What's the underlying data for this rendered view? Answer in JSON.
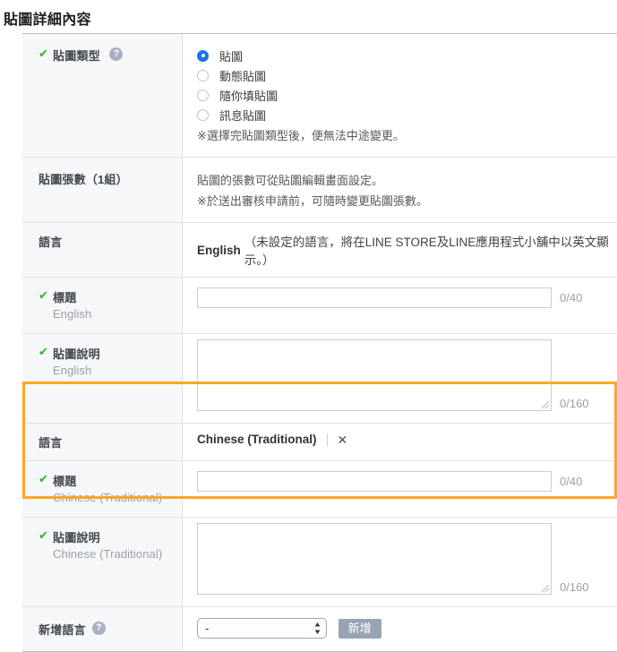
{
  "page": {
    "title": "貼圖詳細內容"
  },
  "colors": {
    "accent_blue": "#1a73e8",
    "check_green": "#2db52d",
    "highlight_orange": "#f9a825",
    "help_icon_gray": "#a7b0c0",
    "button_gray": "#9aa3b6",
    "label_bg": "#f6f7f9",
    "border": "#dfe2e7"
  },
  "rows": {
    "sticker_type": {
      "label": "貼圖類型",
      "help_icon": "question-mark-icon",
      "check_icon": "check-icon",
      "options": [
        {
          "label": "貼圖",
          "selected": true
        },
        {
          "label": "動態貼圖",
          "selected": false
        },
        {
          "label": "隨你填貼圖",
          "selected": false
        },
        {
          "label": "訊息貼圖",
          "selected": false
        }
      ],
      "note": "※選擇完貼圖類型後，便無法中途變更。"
    },
    "sticker_count": {
      "label": "貼圖張數（1組）",
      "note_line1": "貼圖的張數可從貼圖編輯畫面設定。",
      "note_line2": "※於送出審核申請前，可隨時變更貼圖張數。"
    },
    "language_en": {
      "label": "語言",
      "name": "English",
      "note": "（未設定的語言，將在LINE STORE及LINE應用程式小舖中以英文顯示。）"
    },
    "title_en": {
      "label": "標題",
      "sublabel": "English",
      "check_icon": "check-icon",
      "value": "",
      "placeholder": "",
      "counter": "0/40"
    },
    "desc_en": {
      "label": "貼圖說明",
      "sublabel": "English",
      "check_icon": "check-icon",
      "value": "",
      "placeholder": "",
      "counter": "0/160"
    },
    "language_zh": {
      "label": "語言",
      "name": "Chinese (Traditional)",
      "close_label": "✕"
    },
    "title_zh": {
      "label": "標題",
      "sublabel": "Chinese (Traditional)",
      "check_icon": "check-icon",
      "value": "",
      "placeholder": "",
      "counter": "0/40"
    },
    "desc_zh": {
      "label": "貼圖說明",
      "sublabel": "Chinese (Traditional)",
      "check_icon": "check-icon",
      "value": "",
      "placeholder": "",
      "counter": "0/160"
    },
    "add_language": {
      "label": "新增語言",
      "help_icon": "question-mark-icon",
      "selected_option": "-",
      "options": [
        "-"
      ],
      "button_label": "新增"
    }
  }
}
